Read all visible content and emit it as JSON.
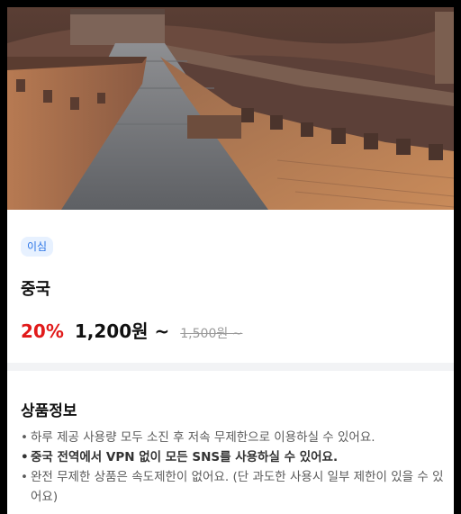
{
  "hero": {
    "image_icon": "great-wall-photo"
  },
  "product": {
    "badge": "이심",
    "name": "중국",
    "discount": "20%",
    "price": "1,200원 ~",
    "original_price": "1,500원 ~"
  },
  "colors": {
    "accent_blue": "#2b74e6",
    "badge_bg": "#e7f1ff",
    "discount_red": "#e11a1a"
  },
  "info": {
    "title": "상품정보",
    "items": [
      {
        "text": "하루 제공 사용량 모두 소진 후 저속 무제한으로 이용하실 수 있어요."
      },
      {
        "text": "중국 전역에서 VPN 없이 모든 SNS를 사용하실 수 있어요."
      },
      {
        "text": "완전 무제한 상품은 속도제한이 없어요. (단 과도한 사용시 일부 제한이 있을 수 있어요)"
      }
    ]
  }
}
